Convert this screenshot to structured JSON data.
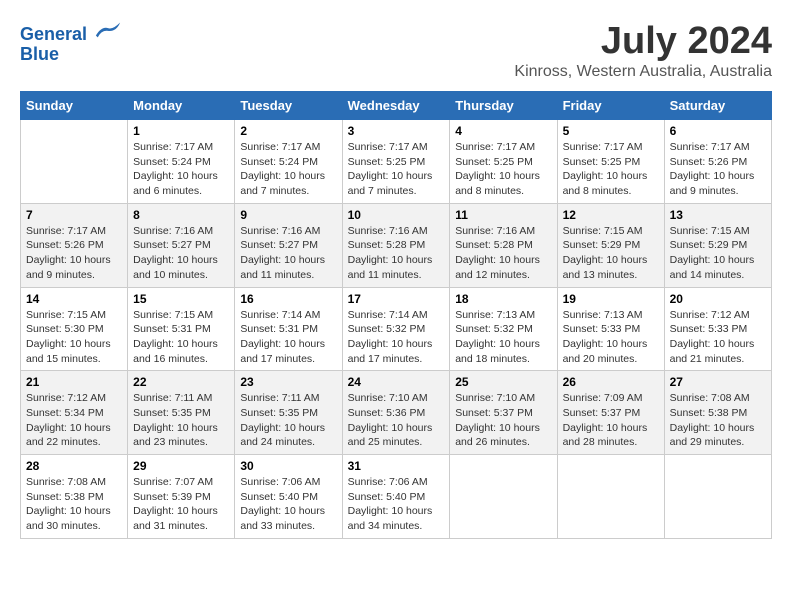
{
  "header": {
    "logo_line1": "General",
    "logo_line2": "Blue",
    "title": "July 2024",
    "subtitle": "Kinross, Western Australia, Australia"
  },
  "calendar": {
    "days_of_week": [
      "Sunday",
      "Monday",
      "Tuesday",
      "Wednesday",
      "Thursday",
      "Friday",
      "Saturday"
    ],
    "weeks": [
      [
        {
          "num": "",
          "info": ""
        },
        {
          "num": "1",
          "info": "Sunrise: 7:17 AM\nSunset: 5:24 PM\nDaylight: 10 hours\nand 6 minutes."
        },
        {
          "num": "2",
          "info": "Sunrise: 7:17 AM\nSunset: 5:24 PM\nDaylight: 10 hours\nand 7 minutes."
        },
        {
          "num": "3",
          "info": "Sunrise: 7:17 AM\nSunset: 5:25 PM\nDaylight: 10 hours\nand 7 minutes."
        },
        {
          "num": "4",
          "info": "Sunrise: 7:17 AM\nSunset: 5:25 PM\nDaylight: 10 hours\nand 8 minutes."
        },
        {
          "num": "5",
          "info": "Sunrise: 7:17 AM\nSunset: 5:25 PM\nDaylight: 10 hours\nand 8 minutes."
        },
        {
          "num": "6",
          "info": "Sunrise: 7:17 AM\nSunset: 5:26 PM\nDaylight: 10 hours\nand 9 minutes."
        }
      ],
      [
        {
          "num": "7",
          "info": "Sunrise: 7:17 AM\nSunset: 5:26 PM\nDaylight: 10 hours\nand 9 minutes."
        },
        {
          "num": "8",
          "info": "Sunrise: 7:16 AM\nSunset: 5:27 PM\nDaylight: 10 hours\nand 10 minutes."
        },
        {
          "num": "9",
          "info": "Sunrise: 7:16 AM\nSunset: 5:27 PM\nDaylight: 10 hours\nand 11 minutes."
        },
        {
          "num": "10",
          "info": "Sunrise: 7:16 AM\nSunset: 5:28 PM\nDaylight: 10 hours\nand 11 minutes."
        },
        {
          "num": "11",
          "info": "Sunrise: 7:16 AM\nSunset: 5:28 PM\nDaylight: 10 hours\nand 12 minutes."
        },
        {
          "num": "12",
          "info": "Sunrise: 7:15 AM\nSunset: 5:29 PM\nDaylight: 10 hours\nand 13 minutes."
        },
        {
          "num": "13",
          "info": "Sunrise: 7:15 AM\nSunset: 5:29 PM\nDaylight: 10 hours\nand 14 minutes."
        }
      ],
      [
        {
          "num": "14",
          "info": "Sunrise: 7:15 AM\nSunset: 5:30 PM\nDaylight: 10 hours\nand 15 minutes."
        },
        {
          "num": "15",
          "info": "Sunrise: 7:15 AM\nSunset: 5:31 PM\nDaylight: 10 hours\nand 16 minutes."
        },
        {
          "num": "16",
          "info": "Sunrise: 7:14 AM\nSunset: 5:31 PM\nDaylight: 10 hours\nand 17 minutes."
        },
        {
          "num": "17",
          "info": "Sunrise: 7:14 AM\nSunset: 5:32 PM\nDaylight: 10 hours\nand 17 minutes."
        },
        {
          "num": "18",
          "info": "Sunrise: 7:13 AM\nSunset: 5:32 PM\nDaylight: 10 hours\nand 18 minutes."
        },
        {
          "num": "19",
          "info": "Sunrise: 7:13 AM\nSunset: 5:33 PM\nDaylight: 10 hours\nand 20 minutes."
        },
        {
          "num": "20",
          "info": "Sunrise: 7:12 AM\nSunset: 5:33 PM\nDaylight: 10 hours\nand 21 minutes."
        }
      ],
      [
        {
          "num": "21",
          "info": "Sunrise: 7:12 AM\nSunset: 5:34 PM\nDaylight: 10 hours\nand 22 minutes."
        },
        {
          "num": "22",
          "info": "Sunrise: 7:11 AM\nSunset: 5:35 PM\nDaylight: 10 hours\nand 23 minutes."
        },
        {
          "num": "23",
          "info": "Sunrise: 7:11 AM\nSunset: 5:35 PM\nDaylight: 10 hours\nand 24 minutes."
        },
        {
          "num": "24",
          "info": "Sunrise: 7:10 AM\nSunset: 5:36 PM\nDaylight: 10 hours\nand 25 minutes."
        },
        {
          "num": "25",
          "info": "Sunrise: 7:10 AM\nSunset: 5:37 PM\nDaylight: 10 hours\nand 26 minutes."
        },
        {
          "num": "26",
          "info": "Sunrise: 7:09 AM\nSunset: 5:37 PM\nDaylight: 10 hours\nand 28 minutes."
        },
        {
          "num": "27",
          "info": "Sunrise: 7:08 AM\nSunset: 5:38 PM\nDaylight: 10 hours\nand 29 minutes."
        }
      ],
      [
        {
          "num": "28",
          "info": "Sunrise: 7:08 AM\nSunset: 5:38 PM\nDaylight: 10 hours\nand 30 minutes."
        },
        {
          "num": "29",
          "info": "Sunrise: 7:07 AM\nSunset: 5:39 PM\nDaylight: 10 hours\nand 31 minutes."
        },
        {
          "num": "30",
          "info": "Sunrise: 7:06 AM\nSunset: 5:40 PM\nDaylight: 10 hours\nand 33 minutes."
        },
        {
          "num": "31",
          "info": "Sunrise: 7:06 AM\nSunset: 5:40 PM\nDaylight: 10 hours\nand 34 minutes."
        },
        {
          "num": "",
          "info": ""
        },
        {
          "num": "",
          "info": ""
        },
        {
          "num": "",
          "info": ""
        }
      ]
    ]
  }
}
